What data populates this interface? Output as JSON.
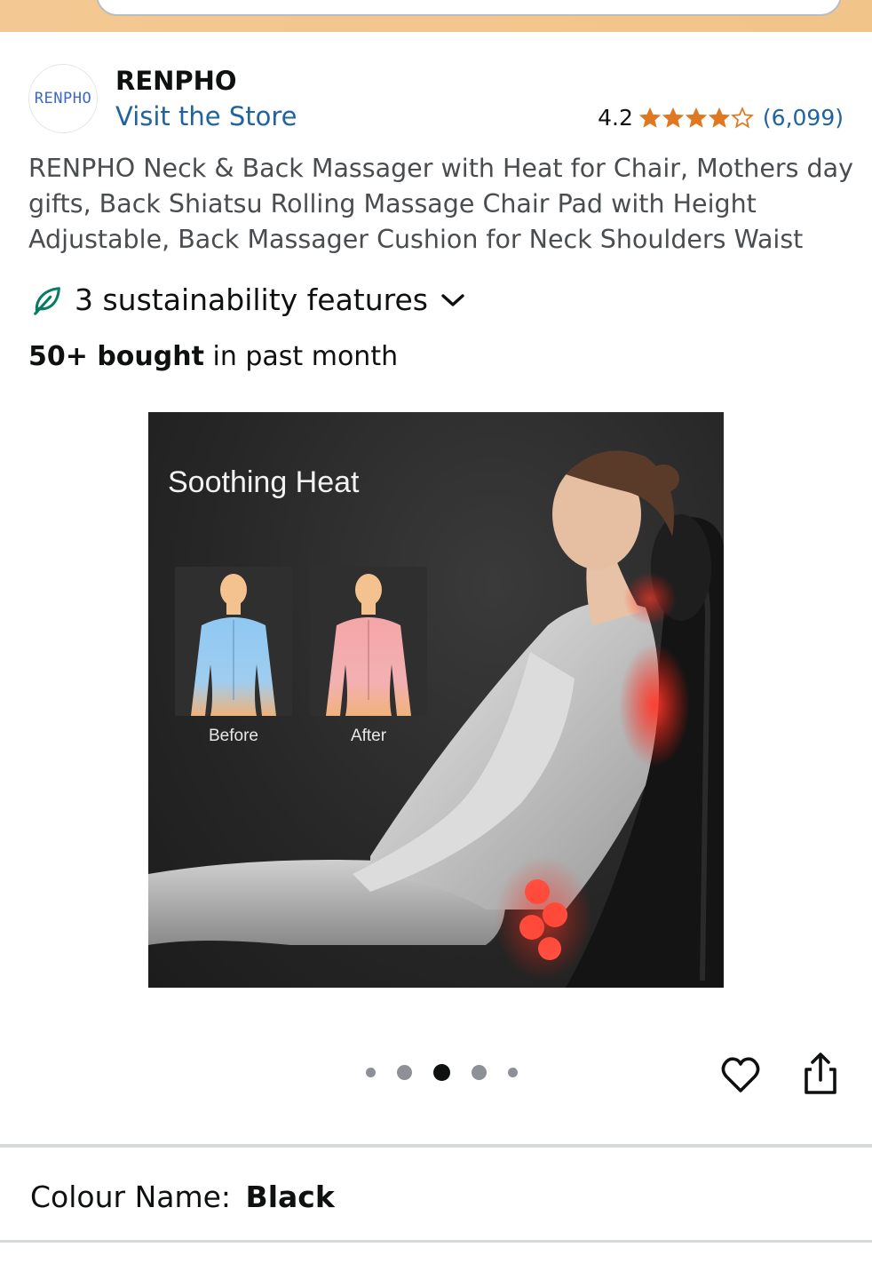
{
  "brand": {
    "logo_text": "RENPHO",
    "name": "RENPHO",
    "store_link": "Visit the Store"
  },
  "rating": {
    "score": "4.2",
    "stars": 4.2,
    "count": "(6,099)"
  },
  "product": {
    "title": "RENPHO Neck & Back Massager with Heat for Chair, Mothers day gifts, Back Shiatsu Rolling Massage Chair Pad with Height Adjustable, Back Massager Cushion for Neck Shoulders Waist",
    "sustainability": "3 sustainability features",
    "bought_bold": "50+ bought",
    "bought_rest": " in past month"
  },
  "image": {
    "heading": "Soothing Heat",
    "before_label": "Before",
    "after_label": "After",
    "carousel_total": 5,
    "carousel_active": 3
  },
  "variation": {
    "label": "Colour Name:",
    "value": "Black"
  },
  "icons": {
    "leaf": "leaf-icon",
    "chevron": "chevron-down-icon",
    "heart": "heart-icon",
    "share": "share-icon"
  },
  "colors": {
    "link": "#2162a1",
    "star": "#de7921",
    "leaf": "#067d62",
    "header": "#f3c892"
  }
}
